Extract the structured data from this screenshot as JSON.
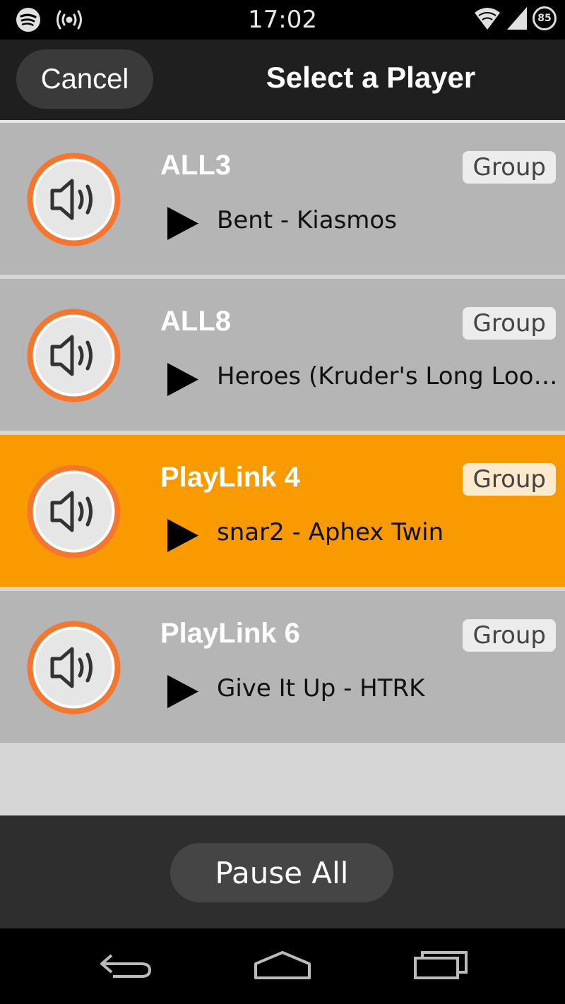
{
  "status_bar": {
    "time": "17:02",
    "battery": "85",
    "icons": [
      "spotify-icon",
      "broadcast-icon",
      "wifi-icon",
      "signal-icon",
      "battery-icon"
    ]
  },
  "header": {
    "cancel_label": "Cancel",
    "title": "Select a Player"
  },
  "players": [
    {
      "name": "ALL3",
      "group_label": "Group",
      "track": "Bent - Kiasmos",
      "selected": false
    },
    {
      "name": "ALL8",
      "group_label": "Group",
      "track": "Heroes (Kruder's Long Loose…",
      "selected": false
    },
    {
      "name": "PlayLink 4",
      "group_label": "Group",
      "track": "snar2 - Aphex Twin",
      "selected": true
    },
    {
      "name": "PlayLink 6",
      "group_label": "Group",
      "track": "Give It Up - HTRK",
      "selected": false
    }
  ],
  "footer": {
    "pause_all_label": "Pause All"
  },
  "nav": [
    "back-icon",
    "home-icon",
    "recents-icon"
  ],
  "colors": {
    "accent": "#f89a00",
    "row_bg": "#b5b5b5",
    "speaker_ring": "#f5772e"
  }
}
